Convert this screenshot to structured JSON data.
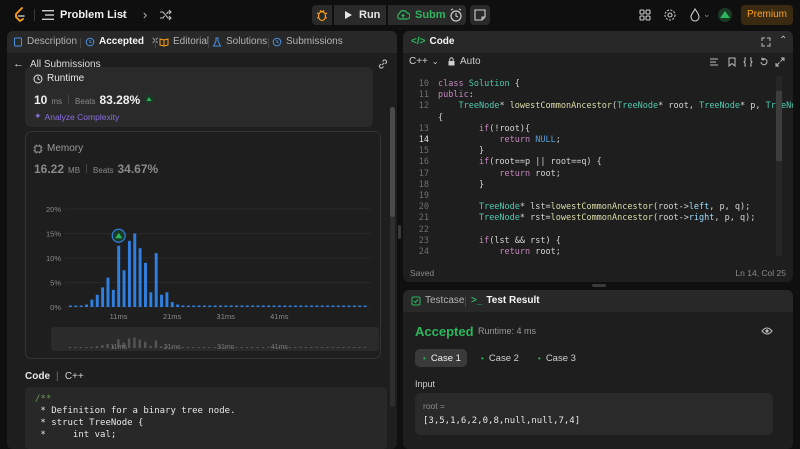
{
  "nav": {
    "problem_list": "Problem List",
    "run": "Run",
    "submit": "Submit",
    "premium": "Premium"
  },
  "left_tabs": [
    {
      "label": "Description"
    },
    {
      "label": "Accepted"
    },
    {
      "label": "Editorial"
    },
    {
      "label": "Solutions"
    },
    {
      "label": "Submissions"
    }
  ],
  "all_submissions": "All Submissions",
  "runtime": {
    "label": "Runtime",
    "value": "10",
    "unit": "ms",
    "beats_label": "Beats",
    "beats": "83.28%",
    "analyze": "Analyze Complexity"
  },
  "memory": {
    "label": "Memory",
    "value": "16.22",
    "unit": "MB",
    "beats_label": "Beats",
    "beats": "34.67%"
  },
  "chart_data": {
    "type": "bar",
    "y_ticks": [
      "20%",
      "15%",
      "10%",
      "5%",
      "0%"
    ],
    "x_ticks": [
      "11ms",
      "21ms",
      "31ms",
      "41ms"
    ],
    "ylim": [
      0,
      20
    ],
    "values": [
      0.3,
      0.3,
      0.3,
      0.5,
      1.5,
      2.5,
      4,
      6,
      3.5,
      12.5,
      7.5,
      13.5,
      15,
      12,
      9,
      3,
      11,
      2.5,
      3,
      1,
      0.5,
      0.3,
      0.3,
      0.3,
      0.3,
      0.3,
      0.3,
      0.3,
      0.3,
      0.3,
      0.3,
      0.3,
      0.3,
      0.3,
      0.3,
      0.3,
      0.3,
      0.3,
      0.3,
      0.3,
      0.3,
      0.3,
      0.3,
      0.3,
      0.3,
      0.3,
      0.3,
      0.3,
      0.3,
      0.3,
      0.3,
      0.3,
      0.3,
      0.3,
      0.3,
      0.3
    ],
    "highlight_index": 9,
    "bar_color": "#2f7fe0"
  },
  "code_preview": {
    "label": "Code",
    "lang": "C++",
    "lines": [
      "/**",
      " * Definition for a binary tree node.",
      " * struct TreeNode {",
      " *     int val;"
    ]
  },
  "code_panel": {
    "title": "Code",
    "lang": "C++",
    "auto": "Auto",
    "saved": "Saved",
    "cursor": "Ln 14, Col 25",
    "lines": [
      {
        "n": "10",
        "t": "class Solution {"
      },
      {
        "n": "11",
        "t": "public:"
      },
      {
        "n": "12",
        "t": "    TreeNode* lowestCommonAncestor(TreeNode* root, TreeNode* p, TreeNode* q)"
      },
      {
        "n": "",
        "t": "{"
      },
      {
        "n": "13",
        "t": "        if(!root){"
      },
      {
        "n": "14",
        "t": "            return NULL;"
      },
      {
        "n": "15",
        "t": "        }"
      },
      {
        "n": "16",
        "t": "        if(root==p || root==q) {"
      },
      {
        "n": "17",
        "t": "            return root;"
      },
      {
        "n": "18",
        "t": "        }"
      },
      {
        "n": "19",
        "t": ""
      },
      {
        "n": "20",
        "t": "        TreeNode* lst=lowestCommonAncestor(root->left, p, q);"
      },
      {
        "n": "21",
        "t": "        TreeNode* rst=lowestCommonAncestor(root->right, p, q);"
      },
      {
        "n": "22",
        "t": ""
      },
      {
        "n": "23",
        "t": "        if(lst && rst) {"
      },
      {
        "n": "24",
        "t": "            return root;"
      }
    ]
  },
  "result_panel": {
    "testcase_tab": "Testcase",
    "result_tab": "Test Result",
    "status": "Accepted",
    "runtime": "Runtime: 4 ms",
    "cases": [
      "Case 1",
      "Case 2",
      "Case 3"
    ],
    "input_label": "Input",
    "var_label": "root =",
    "var_value": "[3,5,1,6,2,0,8,null,null,7,4]"
  },
  "colors": {
    "accent_green": "#2db55d",
    "accent_blue": "#2f7fe0",
    "premium": "#ffa116"
  }
}
